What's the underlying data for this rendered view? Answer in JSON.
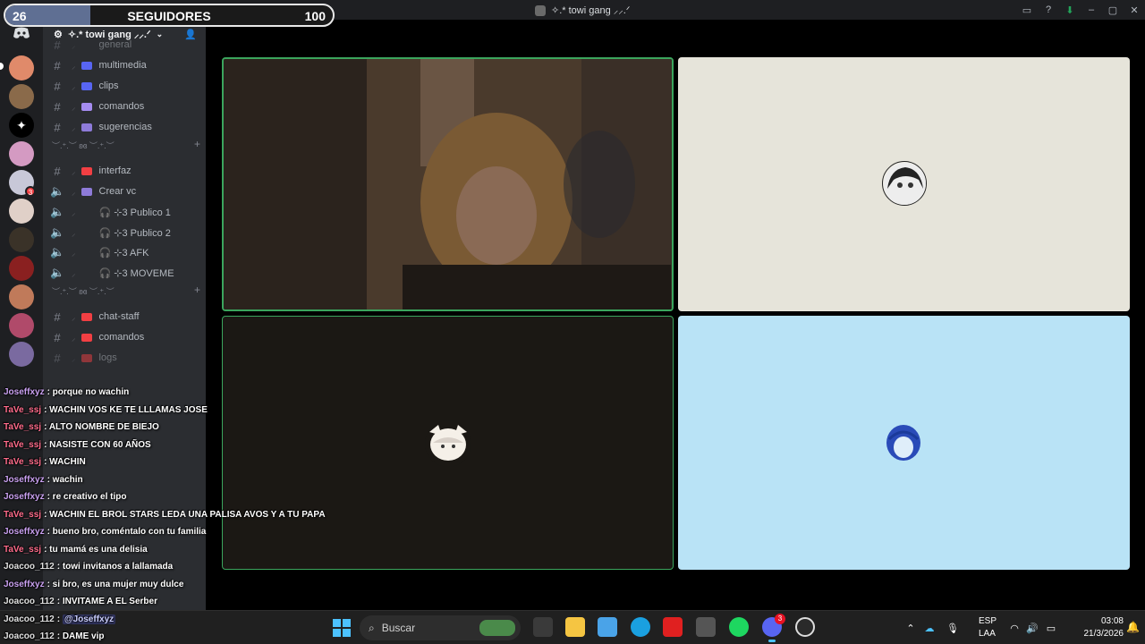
{
  "follower_goal": {
    "current": "26",
    "label": "SEGUIDORES",
    "goal": "100",
    "progress_fraction": 0.26
  },
  "window": {
    "title": "✧.* towi gang ⸝⸝.ᐟ"
  },
  "server": {
    "name": "✧.* towi gang ⸝⸝.ᐟ"
  },
  "channels": [
    {
      "icon": "hash",
      "label": "general"
    },
    {
      "icon": "hash",
      "label": "multimedia",
      "color": "#5865f2"
    },
    {
      "icon": "hash",
      "label": "clips",
      "color": "#5865f2"
    },
    {
      "icon": "hash",
      "label": "comandos",
      "color": "#a58cf0"
    },
    {
      "icon": "hash",
      "label": "sugerencias",
      "color": "#8e7bd9"
    },
    {
      "icon": "hash",
      "label": "interfaz",
      "color": "#f23f43"
    },
    {
      "icon": "speaker",
      "label": "Crear vc",
      "color": "#8e7bd9"
    },
    {
      "icon": "speaker",
      "label": "🎧 ⊹3 Publico 1"
    },
    {
      "icon": "speaker",
      "label": "🎧 ⊹3 Publico 2"
    },
    {
      "icon": "speaker",
      "label": "🎧 ⊹3 AFK"
    },
    {
      "icon": "speaker",
      "label": "🎧 ⊹3 MOVEME"
    },
    {
      "icon": "hash",
      "label": "chat-staff",
      "color": "#f23f43"
    },
    {
      "icon": "hash",
      "label": "comandos",
      "color": "#f23f43"
    },
    {
      "icon": "hash",
      "label": "logs",
      "color": "#f23f43"
    }
  ],
  "categories": [
    {
      "label": "︶.⁺.︶ ʚɞ ︶.⁺.︶"
    },
    {
      "label": "︶.⁺.︶ ʚɞ ︶.⁺.︶"
    }
  ],
  "chat": [
    {
      "user": "Joseffxyz",
      "color": "#c9a0f0",
      "text": ": porque no wachin"
    },
    {
      "user": "TaVe_ssj",
      "color": "#ff6b8a",
      "text": ": WACHIN VOS KE TE LLLAMAS JOSE"
    },
    {
      "user": "TaVe_ssj",
      "color": "#ff6b8a",
      "text": ": ALTO NOMBRE DE BIEJO"
    },
    {
      "user": "TaVe_ssj",
      "color": "#ff6b8a",
      "text": ": NASISTE CON 60 AÑOS"
    },
    {
      "user": "TaVe_ssj",
      "color": "#ff6b8a",
      "text": ": WACHIN"
    },
    {
      "user": "Joseffxyz",
      "color": "#c9a0f0",
      "text": ": wachin"
    },
    {
      "user": "Joseffxyz",
      "color": "#c9a0f0",
      "text": ": re creativo el tipo"
    },
    {
      "user": "TaVe_ssj",
      "color": "#ff6b8a",
      "text": ": WACHIN EL BROL STARS LEDA UNA PALISA AVOS Y A TU PAPA"
    },
    {
      "user": "Joseffxyz",
      "color": "#c9a0f0",
      "text": ": bueno bro, coméntalo con tu familia"
    },
    {
      "user": "TaVe_ssj",
      "color": "#ff6b8a",
      "text": ": tu mamá es una delisia"
    },
    {
      "user": "Joacoo_112",
      "color": "#e0e0e0",
      "text": ": towi invitanos a lallamada"
    },
    {
      "user": "Joseffxyz",
      "color": "#c9a0f0",
      "text": ": si bro, es una mujer muy dulce"
    },
    {
      "user": "Joacoo_112",
      "color": "#e0e0e0",
      "text": ": INVITAME A EL Serber"
    },
    {
      "user": "Joacoo_112",
      "color": "#e0e0e0",
      "text": ": ",
      "mention": "@Joseffxyz"
    },
    {
      "user": "Joacoo_112",
      "color": "#e0e0e0",
      "text": ": DAME vip"
    }
  ],
  "taskbar": {
    "search_placeholder": "Buscar",
    "language": "ESP",
    "layout": "LAA",
    "time": "03:08",
    "date": "21/3/2026",
    "discord_badge": "3"
  },
  "colors": {
    "accent_speaking": "#3ba55d",
    "discord_bg": "#2b2d31",
    "taskbar_bg": "#202020"
  }
}
